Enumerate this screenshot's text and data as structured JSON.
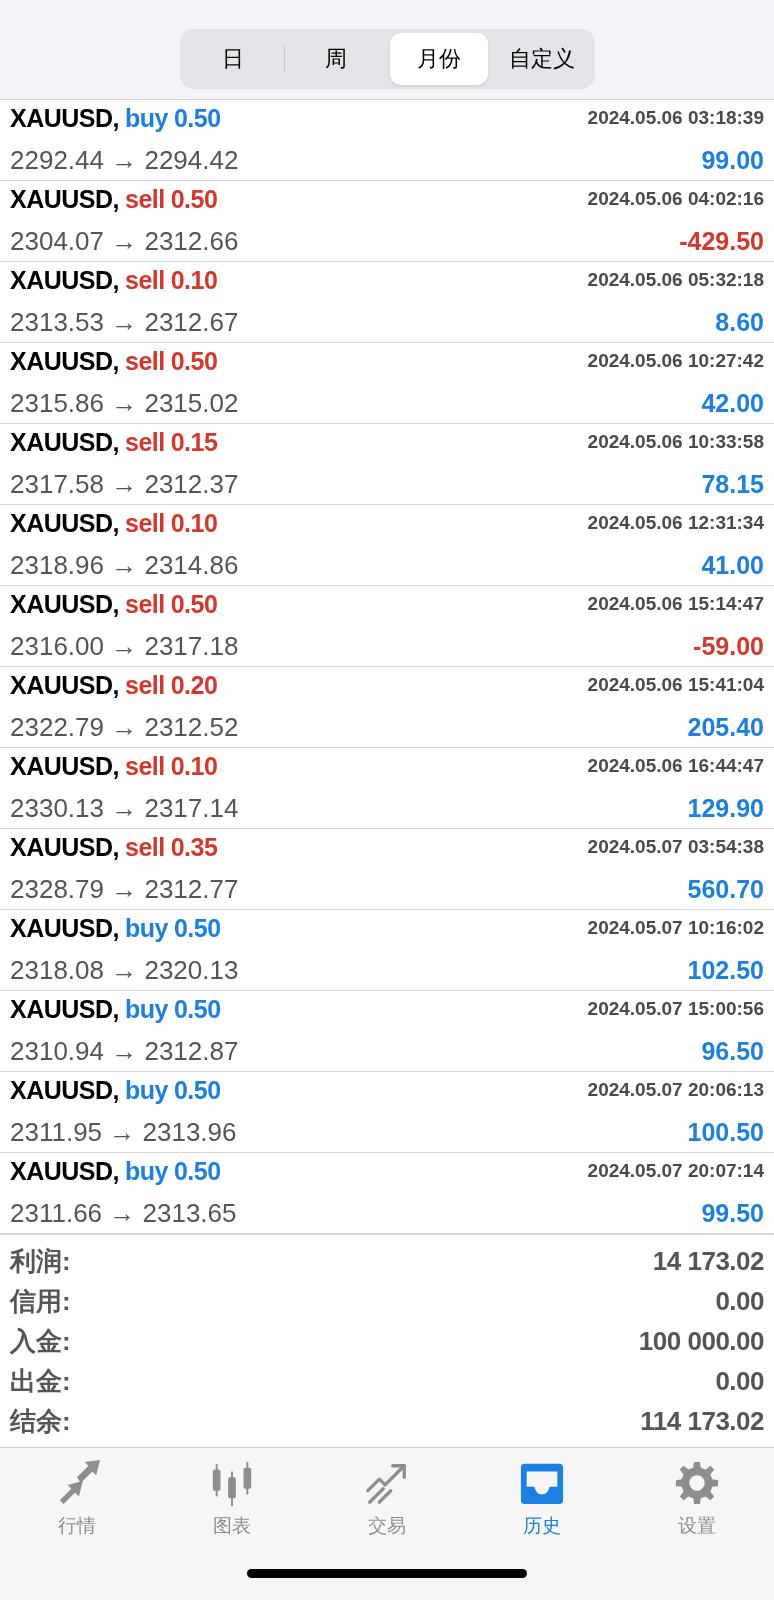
{
  "periods": [
    {
      "label": "日",
      "selected": false
    },
    {
      "label": "周",
      "selected": false
    },
    {
      "label": "月份",
      "selected": true
    },
    {
      "label": "自定义",
      "selected": false
    }
  ],
  "deals": [
    {
      "symbol": "XAUUSD,",
      "type": "buy",
      "volume": "0.50",
      "time": "2024.05.06 03:18:39",
      "prices": "2292.44 → 2294.42",
      "profit": "99.00",
      "loss": false
    },
    {
      "symbol": "XAUUSD,",
      "type": "sell",
      "volume": "0.50",
      "time": "2024.05.06 04:02:16",
      "prices": "2304.07 → 2312.66",
      "profit": "-429.50",
      "loss": true
    },
    {
      "symbol": "XAUUSD,",
      "type": "sell",
      "volume": "0.10",
      "time": "2024.05.06 05:32:18",
      "prices": "2313.53 → 2312.67",
      "profit": "8.60",
      "loss": false
    },
    {
      "symbol": "XAUUSD,",
      "type": "sell",
      "volume": "0.50",
      "time": "2024.05.06 10:27:42",
      "prices": "2315.86 → 2315.02",
      "profit": "42.00",
      "loss": false
    },
    {
      "symbol": "XAUUSD,",
      "type": "sell",
      "volume": "0.15",
      "time": "2024.05.06 10:33:58",
      "prices": "2317.58 → 2312.37",
      "profit": "78.15",
      "loss": false
    },
    {
      "symbol": "XAUUSD,",
      "type": "sell",
      "volume": "0.10",
      "time": "2024.05.06 12:31:34",
      "prices": "2318.96 → 2314.86",
      "profit": "41.00",
      "loss": false
    },
    {
      "symbol": "XAUUSD,",
      "type": "sell",
      "volume": "0.50",
      "time": "2024.05.06 15:14:47",
      "prices": "2316.00 → 2317.18",
      "profit": "-59.00",
      "loss": true
    },
    {
      "symbol": "XAUUSD,",
      "type": "sell",
      "volume": "0.20",
      "time": "2024.05.06 15:41:04",
      "prices": "2322.79 → 2312.52",
      "profit": "205.40",
      "loss": false
    },
    {
      "symbol": "XAUUSD,",
      "type": "sell",
      "volume": "0.10",
      "time": "2024.05.06 16:44:47",
      "prices": "2330.13 → 2317.14",
      "profit": "129.90",
      "loss": false
    },
    {
      "symbol": "XAUUSD,",
      "type": "sell",
      "volume": "0.35",
      "time": "2024.05.07 03:54:38",
      "prices": "2328.79 → 2312.77",
      "profit": "560.70",
      "loss": false
    },
    {
      "symbol": "XAUUSD,",
      "type": "buy",
      "volume": "0.50",
      "time": "2024.05.07 10:16:02",
      "prices": "2318.08 → 2320.13",
      "profit": "102.50",
      "loss": false
    },
    {
      "symbol": "XAUUSD,",
      "type": "buy",
      "volume": "0.50",
      "time": "2024.05.07 15:00:56",
      "prices": "2310.94 → 2312.87",
      "profit": "96.50",
      "loss": false
    },
    {
      "symbol": "XAUUSD,",
      "type": "buy",
      "volume": "0.50",
      "time": "2024.05.07 20:06:13",
      "prices": "2311.95 → 2313.96",
      "profit": "100.50",
      "loss": false
    },
    {
      "symbol": "XAUUSD,",
      "type": "buy",
      "volume": "0.50",
      "time": "2024.05.07 20:07:14",
      "prices": "2311.66 → 2313.65",
      "profit": "99.50",
      "loss": false
    }
  ],
  "summary": [
    {
      "label": "利润:",
      "value": "14 173.02"
    },
    {
      "label": "信用:",
      "value": "0.00"
    },
    {
      "label": "入金:",
      "value": "100 000.00"
    },
    {
      "label": "出金:",
      "value": "0.00"
    },
    {
      "label": "结余:",
      "value": "114 173.02"
    }
  ],
  "tab_bar": [
    {
      "label": "行情",
      "kind": "quotes",
      "selected": false
    },
    {
      "label": "图表",
      "kind": "chart",
      "selected": false
    },
    {
      "label": "交易",
      "kind": "trade",
      "selected": false
    },
    {
      "label": "历史",
      "kind": "history",
      "selected": true
    },
    {
      "label": "设置",
      "kind": "settings",
      "selected": false
    }
  ]
}
